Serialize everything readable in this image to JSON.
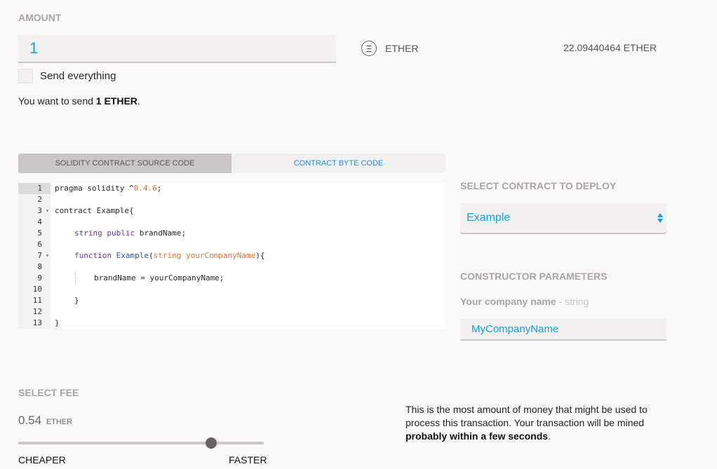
{
  "amount": {
    "label": "AMOUNT",
    "value": "1",
    "currency_icon": "ether-icon",
    "currency_glyph": "Ξ",
    "currency": "ETHER",
    "balance": "22.09440464 ETHER",
    "send_everything_label": "Send everything",
    "send_everything_checked": false,
    "summary_prefix": "You want to send ",
    "summary_amount": "1 ETHER",
    "summary_suffix": "."
  },
  "tabs": [
    {
      "label": "SOLIDITY CONTRACT SOURCE CODE",
      "active": true
    },
    {
      "label": "CONTRACT BYTE CODE",
      "active": false
    }
  ],
  "editor": {
    "active_line": 1,
    "lines": [
      {
        "n": "1",
        "fold": false,
        "indent": 0,
        "tokens": [
          [
            "",
            "pragma solidity ^"
          ],
          [
            "num",
            "0.4.6"
          ],
          [
            "",
            ";"
          ]
        ]
      },
      {
        "n": "2",
        "fold": false,
        "indent": 0,
        "tokens": []
      },
      {
        "n": "3",
        "fold": true,
        "indent": 0,
        "tokens": [
          [
            "",
            "contract Example{"
          ]
        ]
      },
      {
        "n": "4",
        "fold": false,
        "indent": 0,
        "tokens": []
      },
      {
        "n": "5",
        "fold": false,
        "indent": 1,
        "tokens": [
          [
            "kw",
            "string"
          ],
          [
            "",
            " "
          ],
          [
            "kw",
            "public"
          ],
          [
            "",
            " brandName;"
          ]
        ]
      },
      {
        "n": "6",
        "fold": false,
        "indent": 0,
        "tokens": []
      },
      {
        "n": "7",
        "fold": true,
        "indent": 1,
        "tokens": [
          [
            "kw",
            "function"
          ],
          [
            "",
            " "
          ],
          [
            "fn",
            "Example"
          ],
          [
            "",
            "("
          ],
          [
            "param",
            "string yourCompanyName"
          ],
          [
            "",
            "){"
          ]
        ]
      },
      {
        "n": "8",
        "fold": false,
        "indent": 0,
        "tokens": []
      },
      {
        "n": "9",
        "fold": false,
        "indent": 2,
        "tokens": [
          [
            "",
            "brandName = yourCompanyName;"
          ]
        ]
      },
      {
        "n": "10",
        "fold": false,
        "indent": 0,
        "tokens": []
      },
      {
        "n": "11",
        "fold": false,
        "indent": 1,
        "tokens": [
          [
            "",
            "}"
          ]
        ]
      },
      {
        "n": "12",
        "fold": false,
        "indent": 0,
        "tokens": []
      },
      {
        "n": "13",
        "fold": false,
        "indent": 0,
        "tokens": [
          [
            "",
            "}"
          ]
        ]
      }
    ]
  },
  "deploy": {
    "label": "SELECT CONTRACT TO DEPLOY",
    "selected": "Example"
  },
  "constructor": {
    "label": "CONSTRUCTOR PARAMETERS",
    "param_name": "Your company name",
    "param_type": " - string",
    "param_value": "MyCompanyName"
  },
  "fee": {
    "label": "SELECT FEE",
    "value": "0.54",
    "unit": "ETHER",
    "slider_fraction": 0.785,
    "cheaper_label": "CHEAPER",
    "faster_label": "FASTER",
    "description_prefix": "This is the most amount of money that might be used to process this transaction. Your transaction will be mined ",
    "description_bold": "probably within a few seconds",
    "description_suffix": "."
  }
}
